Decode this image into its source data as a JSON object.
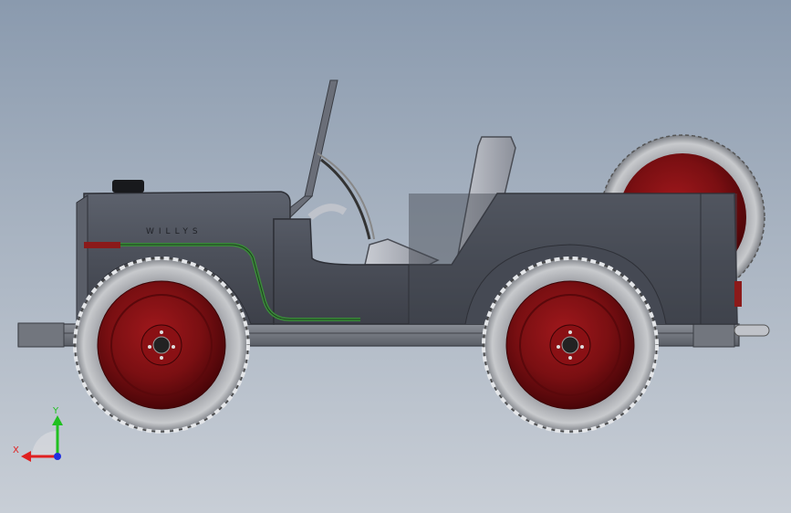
{
  "app": {
    "background_top": "#8a9aae",
    "background_bottom": "#c8ced6"
  },
  "model": {
    "hood_lettering": "WILLYS",
    "body_color": "#4a4e58",
    "wheel_color": "#7a0f12",
    "trim_color": "#3a8a3a"
  },
  "triad": {
    "x_label": "X",
    "y_label": "Y",
    "x_color": "#e02020",
    "y_color": "#20c020",
    "z_color": "#2030e0"
  }
}
